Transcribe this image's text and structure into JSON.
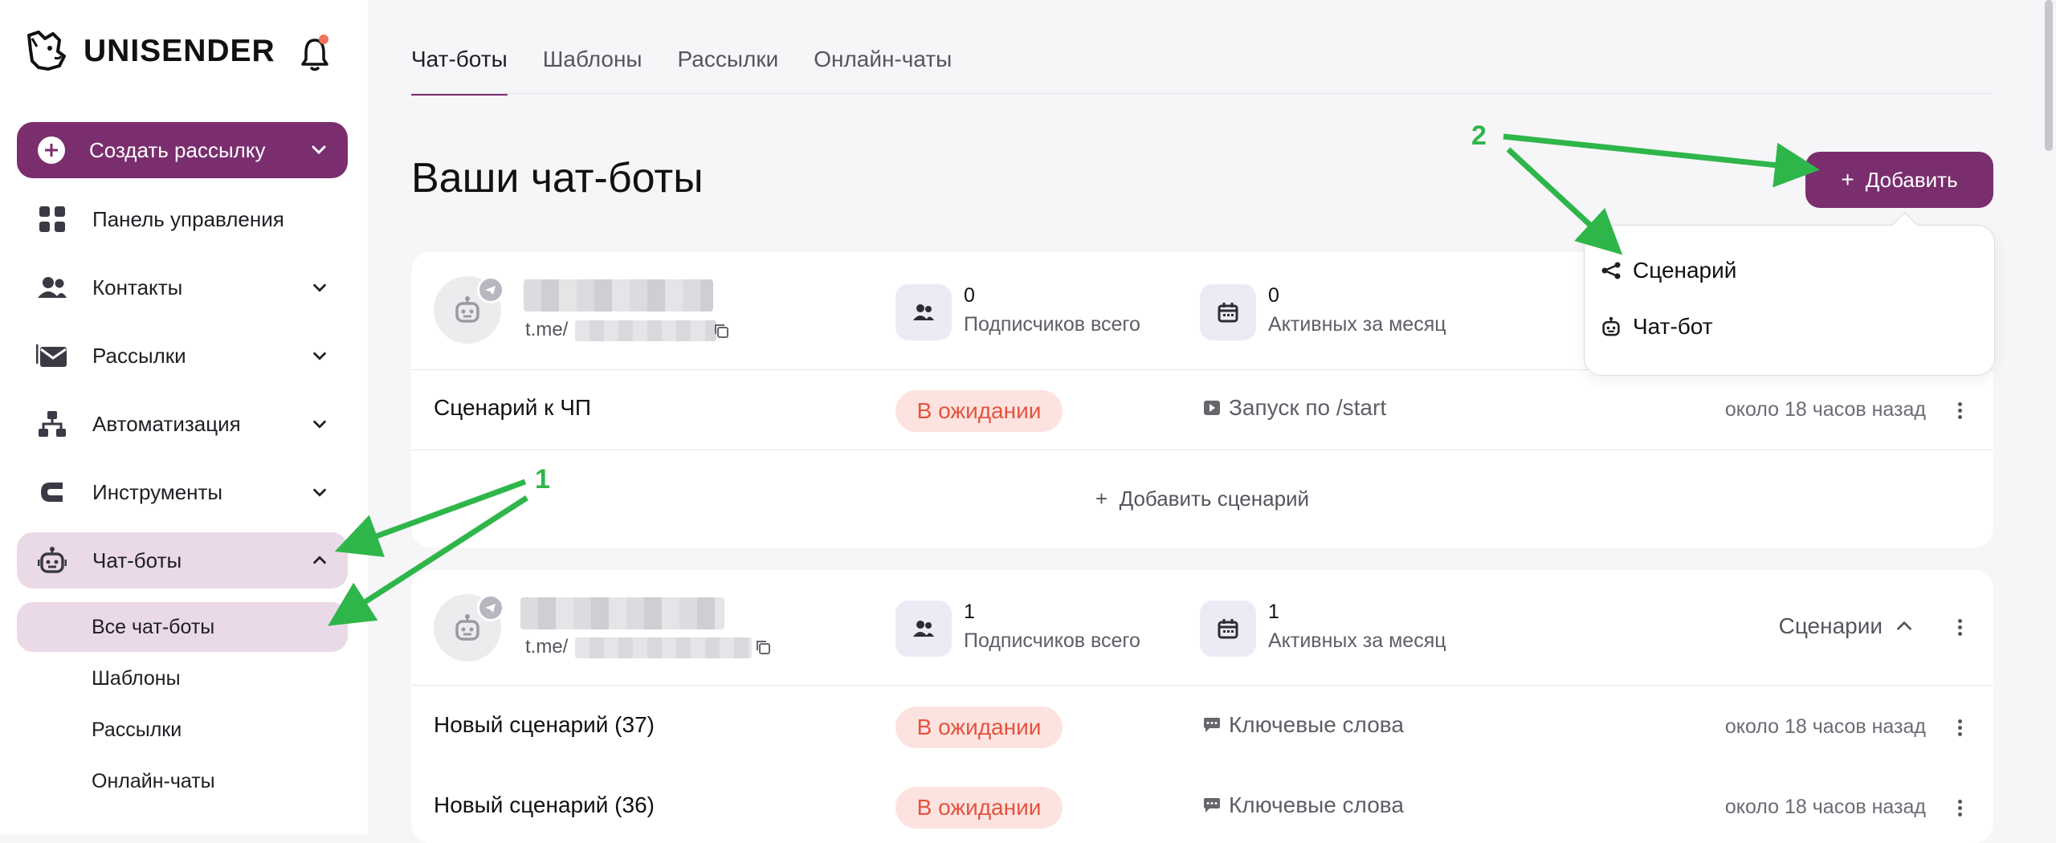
{
  "brand": {
    "name": "UNISENDER"
  },
  "sidebar": {
    "create_label": "Создать рассылку",
    "items": [
      {
        "label": "Панель управления",
        "icon": "dashboard-icon"
      },
      {
        "label": "Контакты",
        "icon": "contacts-icon"
      },
      {
        "label": "Рассылки",
        "icon": "mail-icon"
      },
      {
        "label": "Автоматизация",
        "icon": "automation-icon"
      },
      {
        "label": "Инструменты",
        "icon": "tools-icon"
      },
      {
        "label": "Чат-боты",
        "icon": "robot-icon"
      }
    ],
    "subitems": [
      {
        "label": "Все чат-боты"
      },
      {
        "label": "Шаблоны"
      },
      {
        "label": "Рассылки"
      },
      {
        "label": "Онлайн-чаты"
      }
    ]
  },
  "tabs": [
    {
      "label": "Чат-боты"
    },
    {
      "label": "Шаблоны"
    },
    {
      "label": "Рассылки"
    },
    {
      "label": "Онлайн-чаты"
    }
  ],
  "page": {
    "title": "Ваши чат-боты",
    "add_label": "Добавить"
  },
  "dropdown": {
    "items": [
      {
        "label": "Сценарий"
      },
      {
        "label": "Чат-бот"
      }
    ]
  },
  "bots": [
    {
      "link_prefix": "t.me/",
      "subscribers": {
        "value": "0",
        "label": "Подписчиков всего"
      },
      "active": {
        "value": "0",
        "label": "Активных за месяц"
      },
      "scenarios": [
        {
          "name": "Сценарий к ЧП",
          "status": "В ожидании",
          "trigger": "Запуск по /start",
          "time": "около 18 часов назад"
        }
      ],
      "add_scenario_label": "Добавить сценарий"
    },
    {
      "link_prefix": "t.me/",
      "subscribers": {
        "value": "1",
        "label": "Подписчиков всего"
      },
      "active": {
        "value": "1",
        "label": "Активных за месяц"
      },
      "toggle_label": "Сценарии",
      "scenarios": [
        {
          "name": "Новый сценарий (37)",
          "status": "В ожидании",
          "trigger": "Ключевые слова",
          "time": "около 18 часов назад"
        },
        {
          "name": "Новый сценарий (36)",
          "status": "В ожидании",
          "trigger": "Ключевые слова",
          "time": "около 18 часов назад"
        }
      ]
    }
  ],
  "annotations": {
    "one": "1",
    "two": "2"
  },
  "colors": {
    "brand": "#7a2e6e",
    "active_bg": "#ead9e7",
    "status_bg": "#fde3e0",
    "status_text": "#e5533e",
    "arrow": "#2fb64a"
  }
}
